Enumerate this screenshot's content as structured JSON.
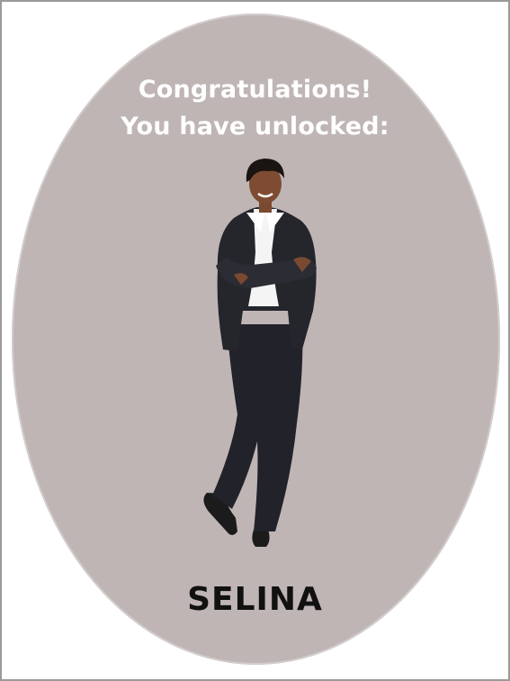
{
  "unlock_card": {
    "headline_line1": "Congratulations!",
    "headline_line2": "You have unlocked:",
    "character_name": "SELINA"
  },
  "colors": {
    "oval_background": "#bfb5b5",
    "headline_text": "#ffffff",
    "name_text": "#111111"
  }
}
